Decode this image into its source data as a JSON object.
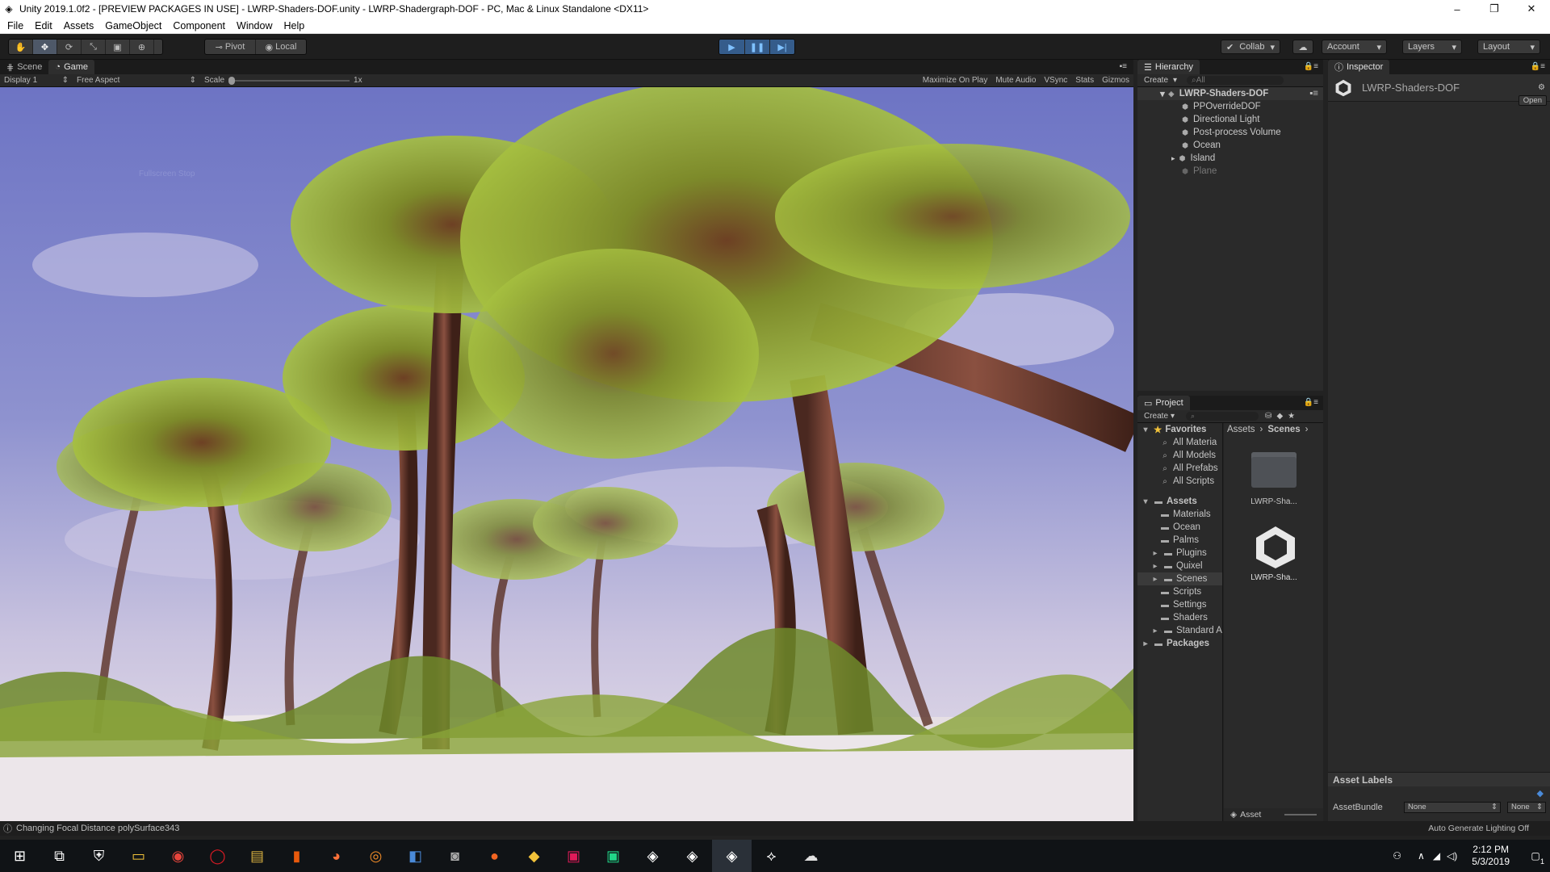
{
  "window": {
    "title": "Unity 2019.1.0f2 - [PREVIEW PACKAGES IN USE] - LWRP-Shaders-DOF.unity - LWRP-Shadergraph-DOF - PC, Mac & Linux Standalone <DX11>",
    "controls": [
      "–",
      "❐",
      "✕"
    ]
  },
  "menu": [
    "File",
    "Edit",
    "Assets",
    "GameObject",
    "Component",
    "Window",
    "Help"
  ],
  "toolbar": {
    "pivot": "Pivot",
    "local": "Local",
    "collab": "Collab",
    "account": "Account",
    "layers": "Layers",
    "layout": "Layout"
  },
  "scene_tabs": {
    "scene": "Scene",
    "game": "Game"
  },
  "game_bar": {
    "display": "Display 1",
    "aspect": "Free Aspect",
    "scale_label": "Scale",
    "scale_value": "1x",
    "maximize": "Maximize On Play",
    "mute": "Mute Audio",
    "vsync": "VSync",
    "stats": "Stats",
    "gizmos": "Gizmos"
  },
  "overlay_text": "Fullscreen Stop",
  "hierarchy": {
    "tab": "Hierarchy",
    "create": "Create",
    "search_placeholder": "All",
    "scene": "LWRP-Shaders-DOF",
    "items": [
      "PPOverrideDOF",
      "Directional Light",
      "Post-process Volume",
      "Ocean",
      "Island",
      "Plane"
    ]
  },
  "project": {
    "tab": "Project",
    "create": "Create",
    "favorites_label": "Favorites",
    "favorites": [
      "All Materia",
      "All Models",
      "All Prefabs",
      "All Scripts"
    ],
    "assets_label": "Assets",
    "folders": [
      "Materials",
      "Ocean",
      "Palms",
      "Plugins",
      "Quixel",
      "Scenes",
      "Scripts",
      "Settings",
      "Shaders",
      "Standard A"
    ],
    "packages_label": "Packages",
    "breadcrumb": [
      "Assets",
      "Scenes"
    ],
    "files": [
      "LWRP-Sha...",
      "LWRP-Sha..."
    ],
    "footer": "Asset"
  },
  "inspector": {
    "tab": "Inspector",
    "object_name": "LWRP-Shaders-DOF",
    "open_button": "Open",
    "asset_labels": "Asset Labels",
    "assetbundle_label": "AssetBundle",
    "assetbundle_value": "None",
    "variant_value": "None",
    "auto_lighting": "Auto Generate Lighting Off"
  },
  "status_message": "Changing Focal Distance polySurface343",
  "taskbar": {
    "time": "2:12 PM",
    "date": "5/3/2019",
    "notifications": "1"
  },
  "colors": {
    "editor_bg": "#2a2a2a",
    "play_accent": "#355c8b",
    "sky": "#7f86c8",
    "sand": "#e8e2e6",
    "palm_leaf": "#8aa62a",
    "trunk": "#6b3a2c"
  }
}
